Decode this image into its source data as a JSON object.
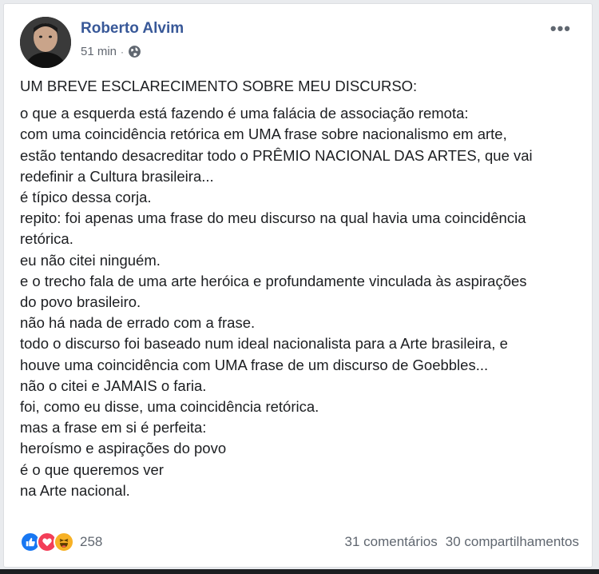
{
  "post": {
    "author": "Roberto Alvim",
    "time": "51 min",
    "time_separator": "·",
    "more_label": "•••",
    "title": "UM BREVE ESCLARECIMENTO SOBRE MEU DISCURSO:",
    "lines": [
      "o que a esquerda está fazendo é uma falácia de associação remota:",
      "com uma coincidência retórica em UMA frase sobre nacionalismo em arte,",
      "estão tentando desacreditar todo o PRÊMIO NACIONAL DAS ARTES, que vai",
      "redefinir a Cultura brasileira...",
      "é típico dessa corja.",
      "repito: foi apenas uma frase do meu discurso na qual havia uma coincidência",
      "retórica.",
      "eu não citei ninguém.",
      "e o trecho fala de uma arte heróica e profundamente vinculada às aspirações",
      "do povo brasileiro.",
      "não há nada de errado com a frase.",
      "todo o discurso foi baseado num ideal nacionalista para a Arte brasileira, e",
      "houve uma coincidência com UMA frase de um discurso de Goebbles...",
      "não o citei e JAMAIS o faria.",
      "foi, como eu disse, uma coincidência retórica.",
      "mas a frase em si é perfeita:",
      "heroísmo e aspirações do povo",
      "é o que queremos ver",
      "na Arte nacional."
    ]
  },
  "footer": {
    "reactions": [
      "like-icon",
      "love-icon",
      "haha-icon"
    ],
    "reaction_count": "258",
    "comments": "31 comentários",
    "shares": "30 compartilhamentos"
  },
  "colors": {
    "author": "#385898",
    "like": "#1877f2",
    "love": "#f33e58",
    "haha": "#f7b125",
    "muted": "#606770"
  }
}
